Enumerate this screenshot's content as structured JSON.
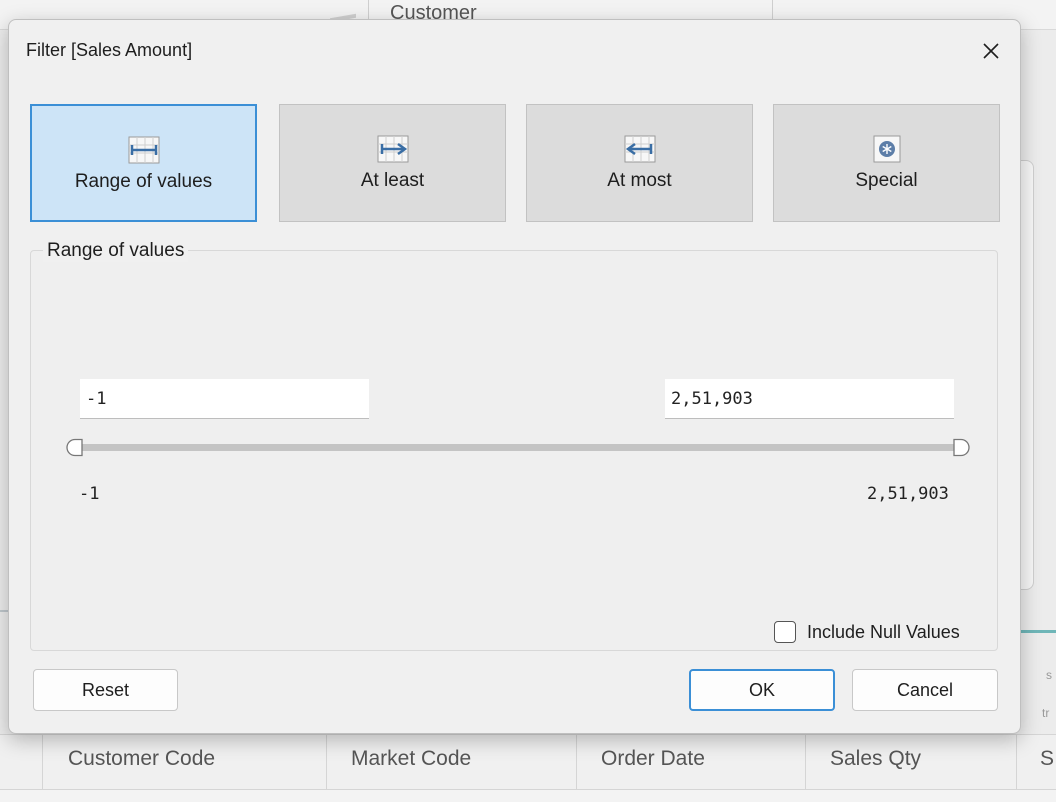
{
  "background": {
    "top_column_label": "Customer",
    "table_headers": [
      "Customer Code",
      "Market Code",
      "Order Date",
      "Sales Qty",
      "S"
    ],
    "partial_texts": [
      "s",
      "tr"
    ]
  },
  "dialog": {
    "title": "Filter [Sales Amount]",
    "close_icon": "close-icon",
    "tabs": [
      {
        "label": "Range of values",
        "icon": "range-of-values-icon",
        "selected": true
      },
      {
        "label": "At least",
        "icon": "at-least-icon",
        "selected": false
      },
      {
        "label": "At most",
        "icon": "at-most-icon",
        "selected": false
      },
      {
        "label": "Special",
        "icon": "special-icon",
        "selected": false
      }
    ],
    "group_label": "Range of values",
    "min_value": "-1",
    "max_value": "2,51,903",
    "range_min_label": "-1",
    "range_max_label": "2,51,903",
    "include_null_label": "Include Null Values",
    "include_null_checked": false,
    "buttons": {
      "reset": "Reset",
      "ok": "OK",
      "cancel": "Cancel"
    }
  },
  "colors": {
    "selected_tab_bg": "#cde4f7",
    "accent": "#3b8fd6",
    "teal_line": "#6fb6b8"
  }
}
